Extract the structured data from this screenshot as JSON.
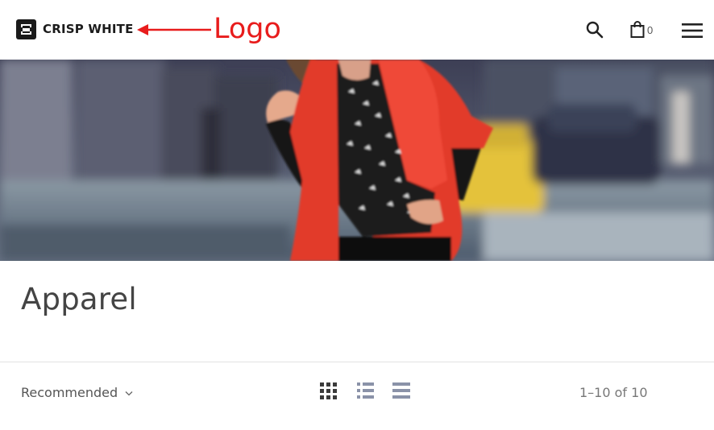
{
  "header": {
    "logo_text": "CRISP WHITE",
    "cart_count": "0",
    "icons": [
      "store-logo-icon",
      "search-icon",
      "shopping-bag-icon",
      "hamburger-menu-icon"
    ]
  },
  "annotation": {
    "label": "Logo",
    "color": "#e81c1c"
  },
  "hero": {
    "description_icon": "hero-banner-image"
  },
  "collection": {
    "title": "Apparel"
  },
  "toolbar": {
    "sort_label": "Recommended",
    "view_modes": [
      "grid-view-icon",
      "list-view-icon",
      "compact-list-view-icon"
    ],
    "active_view": "grid",
    "count_text": "1–10 of 10"
  },
  "colors": {
    "accent_active": "#3a3a3a",
    "icon_inactive": "#8a92a8",
    "annotation_red": "#e81c1c"
  }
}
